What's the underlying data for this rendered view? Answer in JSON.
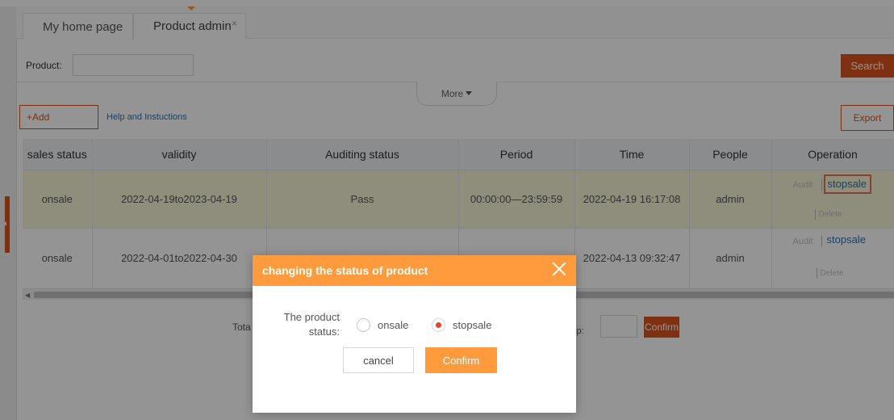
{
  "tabs": {
    "home": "My home page",
    "active": "Product admin",
    "close_glyph": "×"
  },
  "search": {
    "label": "Product:",
    "value": "",
    "button": "Search"
  },
  "more": "More",
  "actions": {
    "add": "+Add",
    "help": "Help and Instuctions",
    "export": "Export"
  },
  "table": {
    "columns": [
      "sales status",
      "validity",
      "Auditing status",
      "Period",
      "Time",
      "People",
      "Operation"
    ],
    "rows": [
      {
        "sales_status": "onsale",
        "validity": "2022-04-19to2023-04-19",
        "auditing": "Pass",
        "period": "00:00:00—23:59:59",
        "time": "2022-04-19 16:17:08",
        "people": "admin",
        "op_audit": "Audit",
        "op_stop": "stopsale",
        "op_delete": "Delete"
      },
      {
        "sales_status": "onsale",
        "validity": "2022-04-01to2022-04-30",
        "auditing": "",
        "period": "",
        "time": "2022-04-13 09:32:47",
        "people": "admin",
        "op_audit": "Audit",
        "op_stop": "stopsale",
        "op_delete": "Delete"
      }
    ]
  },
  "pager": {
    "total_prefix": "Tota",
    "skip_label": "ip:",
    "skip_value": "",
    "confirm": "Confirm"
  },
  "dialog": {
    "title": "changing the status of product",
    "field_label": "The product status:",
    "options": [
      "onsale",
      "stopsale"
    ],
    "selected": "stopsale",
    "cancel": "cancel",
    "confirm": "Confirm"
  },
  "colors": {
    "brand_red": "#d9531e",
    "dialog_orange": "#ff9b3d",
    "row_highlight": "#f6f4d6",
    "link_blue": "#2f6fb1"
  }
}
